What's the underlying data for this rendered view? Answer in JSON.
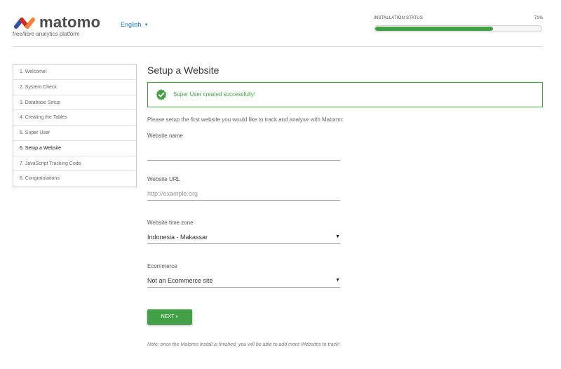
{
  "header": {
    "logo_text": "matomo",
    "tagline": "free/libre analytics platform",
    "language": "English",
    "install_status_label": "INSTALLATION STATUS",
    "install_status_percent": "71%",
    "install_progress": 0.71
  },
  "sidebar": {
    "steps": [
      {
        "label": "1. Welcome!"
      },
      {
        "label": "2. System Check"
      },
      {
        "label": "3. Database Setup"
      },
      {
        "label": "4. Creating the Tables"
      },
      {
        "label": "5. Super User"
      },
      {
        "label": "6. Setup a Website",
        "active": true
      },
      {
        "label": "7. JavaScript Tracking Code"
      },
      {
        "label": "8. Congratulations"
      }
    ]
  },
  "main": {
    "title": "Setup a Website",
    "success_message": "Super User created successfully!",
    "intro": "Please setup the first website you would like to track and analyse with Matomo:",
    "fields": {
      "website_name": {
        "label": "Website name",
        "value": ""
      },
      "website_url": {
        "label": "Website URL",
        "placeholder": "http://example.org"
      },
      "timezone": {
        "label": "Website time zone",
        "value": "Indonesia - Makassar"
      },
      "ecommerce": {
        "label": "Ecommerce",
        "value": "Not an Ecommerce site"
      }
    },
    "next_button": "NEXT »",
    "note": "Note: once the Matomo Install is finished, you will be able to add more Websites to track!"
  },
  "colors": {
    "accent_green": "#43a047",
    "link_blue": "#1b78c7",
    "logo_blue": "#3450a3",
    "logo_red": "#d4291f",
    "logo_orange": "#f38334"
  }
}
